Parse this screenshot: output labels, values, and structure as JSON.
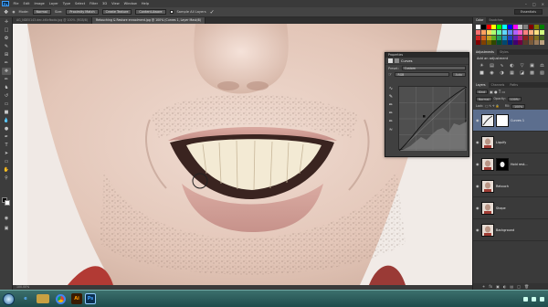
{
  "app": {
    "logo": "Ps"
  },
  "menu": [
    "File",
    "Edit",
    "Image",
    "Layer",
    "Type",
    "Select",
    "Filter",
    "3D",
    "View",
    "Window",
    "Help"
  ],
  "options": {
    "mode_label": "Mode:",
    "mode_value": "Normal",
    "size_label": "Size:",
    "size_value": "Proximity Match",
    "type_value": "Create Texture",
    "content_aware": "Content-Aware",
    "sample_label": "Sample All Layers",
    "workspace": "Essentials"
  },
  "doc_tabs": [
    {
      "label": "AG_NDE0143.dec-k6lcfkodo.jpg @ 100% (RGB/8)",
      "active": false
    },
    {
      "label": "Retouching & Restore enroolment.jpg @ 100% (Curves 1, Layer Mask/8)",
      "active": true
    }
  ],
  "status": {
    "zoom": "100.00%"
  },
  "properties": {
    "title": "Properties",
    "panel_name": "Curves",
    "preset_label": "Preset:",
    "preset_value": "Custom",
    "channel_value": "RGB",
    "auto_label": "Auto"
  },
  "right_tabs": {
    "swatches": [
      "Color",
      "Swatches"
    ],
    "adjustments": [
      "Adjustments",
      "Styles"
    ],
    "layers": [
      "Layers",
      "Channels",
      "Paths"
    ]
  },
  "adjustments": {
    "title": "Add an adjustment"
  },
  "layers_ctrl": {
    "kind": "Kind",
    "blend": "Normal",
    "opacity_label": "Opacity:",
    "opacity": "100%",
    "lock_label": "Lock:",
    "fill_label": "Fill:",
    "fill": "100%"
  },
  "layers": [
    {
      "name": "Curves 1",
      "type": "adjustment",
      "active": true
    },
    {
      "name": "Liquify",
      "type": "photo",
      "active": false
    },
    {
      "name": "Hold rest...",
      "type": "masked",
      "active": false
    },
    {
      "name": "Retouch",
      "type": "photo",
      "active": false
    },
    {
      "name": "Shape",
      "type": "photo",
      "active": false
    },
    {
      "name": "Background",
      "type": "photo",
      "active": false
    }
  ],
  "swatch_colors": [
    "#ffffff",
    "#000000",
    "#ff0000",
    "#ffff00",
    "#00ff00",
    "#00ffff",
    "#0000ff",
    "#ff00ff",
    "#c0c0c0",
    "#808080",
    "#800000",
    "#808000",
    "#008000",
    "#ff6f6f",
    "#ffa060",
    "#ffd860",
    "#b0ff70",
    "#60ffb0",
    "#60d8ff",
    "#6088ff",
    "#b060ff",
    "#ff60c8",
    "#ff8080",
    "#ffb080",
    "#ffe080",
    "#d0ff80",
    "#cc2020",
    "#d06020",
    "#c0a020",
    "#60b020",
    "#20a060",
    "#2090c0",
    "#2040c0",
    "#6020b0",
    "#b02080",
    "#902020",
    "#905020",
    "#807020",
    "#406020",
    "#800000",
    "#804000",
    "#706000",
    "#304800",
    "#005030",
    "#004870",
    "#002080",
    "#400070",
    "#700040",
    "#5a3a2a",
    "#7a5a3a",
    "#9a7a5a",
    "#bba080"
  ],
  "taskbar": {
    "apps": [
      "ie",
      "explorer",
      "chrome",
      "ai",
      "ps"
    ]
  }
}
